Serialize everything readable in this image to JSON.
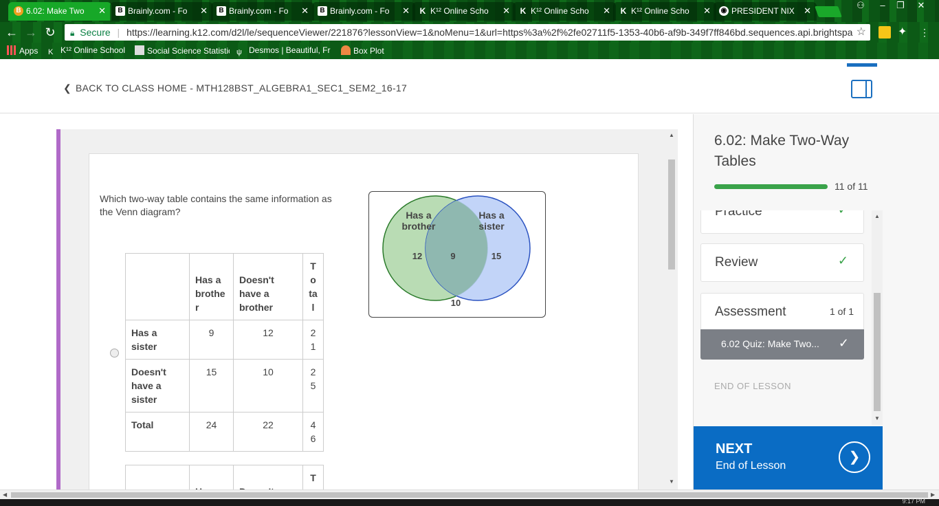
{
  "tabs": [
    {
      "title": "6.02: Make Two",
      "icon": "brainly-orange-icon",
      "active": true
    },
    {
      "title": "Brainly.com - Fo",
      "icon": "brainly-b-icon"
    },
    {
      "title": "Brainly.com - Fo",
      "icon": "brainly-b-icon"
    },
    {
      "title": "Brainly.com - Fo",
      "icon": "brainly-b-icon"
    },
    {
      "title": "K¹² Online Scho",
      "icon": "k12-icon"
    },
    {
      "title": "K¹² Online Scho",
      "icon": "k12-icon"
    },
    {
      "title": "K¹² Online Scho",
      "icon": "k12-icon"
    },
    {
      "title": "PRESIDENT NIX",
      "icon": "globe-icon"
    }
  ],
  "address": {
    "secure_label": "Secure",
    "url": "https://learning.k12.com/d2l/le/sequenceViewer/221876?lessonView=1&noMenu=1&url=https%3a%2f%2fe02711f5-1353-40b6-af9b-349f7ff846bd.sequences.api.brightspa"
  },
  "bookmarks": [
    {
      "label": "Apps"
    },
    {
      "label": "K¹² Online School"
    },
    {
      "label": "Social Science Statistic"
    },
    {
      "label": "Desmos | Beautiful, Fr"
    },
    {
      "label": "Box Plot"
    }
  ],
  "header": {
    "back_label": "BACK TO CLASS HOME - MTH128BST_ALGEBRA1_SEC1_SEM2_16-17"
  },
  "question": {
    "text": "Which two-way table contains the same information as the Venn diagram?"
  },
  "venn": {
    "left_label": "Has a brother",
    "right_label": "Has a sister",
    "left_only": "12",
    "both": "9",
    "right_only": "15",
    "neither": "10",
    "left_color": "#b9dcb4",
    "right_color": "#b7cdf7",
    "overlap_color": "#8fb8b0"
  },
  "table1": {
    "headers": [
      "",
      "Has a brothe r",
      "Doesn't have a brother",
      "T o ta l"
    ],
    "rows": [
      {
        "label": "Has a sister",
        "values": [
          "9",
          "12",
          "2 1"
        ]
      },
      {
        "label": "Doesn't have a sister",
        "values": [
          "15",
          "10",
          "2 5"
        ]
      },
      {
        "label": "Total",
        "values": [
          "24",
          "22",
          "4 6"
        ]
      }
    ]
  },
  "table2_partial": {
    "headers": [
      "",
      "Has a",
      "Doesn't",
      "T"
    ]
  },
  "side": {
    "lesson_title": "6.02: Make Two-Way Tables",
    "progress_text": "11 of 11",
    "progress_fraction": 1.0,
    "items": [
      {
        "label": "Practice",
        "done": true
      },
      {
        "label": "Review",
        "done": true
      },
      {
        "label": "Assessment",
        "count": "1 of 1"
      }
    ],
    "quiz_label": "6.02 Quiz: Make Two...",
    "end_label": "END OF LESSON",
    "next_title": "NEXT",
    "next_sub": "End of Lesson"
  },
  "clock": "9:17 PM"
}
